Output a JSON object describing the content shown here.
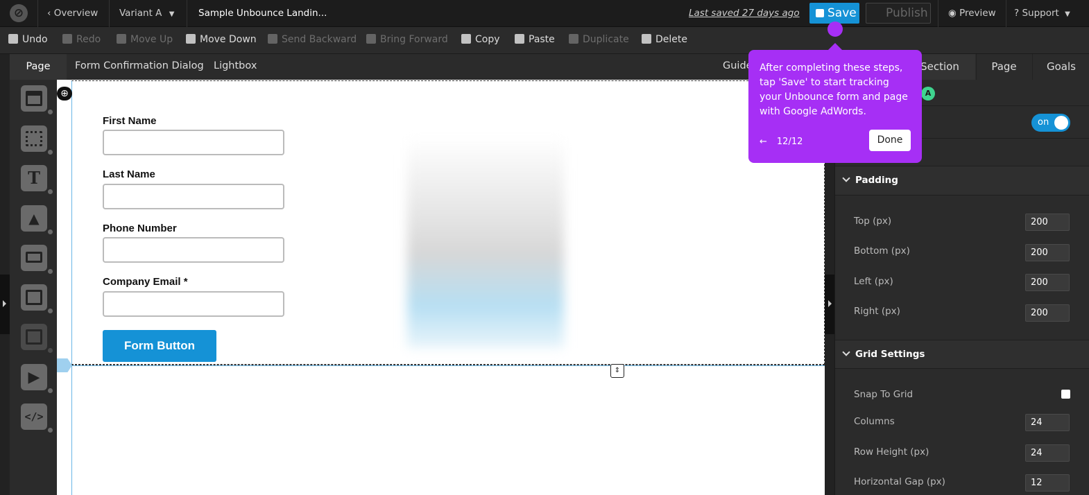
{
  "topbar": {
    "logo": "unbounce-logo-icon",
    "overview": "Overview",
    "variant": "Variant A",
    "page_name": "Sample Unbounce Landin...",
    "last_saved": "Last saved  27 days ago",
    "save": "Save",
    "publish": "Publish",
    "preview": "Preview",
    "support": "Support"
  },
  "toolbar": {
    "undo": "Undo",
    "redo": "Redo",
    "move_up": "Move Up",
    "move_down": "Move Down",
    "send_backward": "Send Backward",
    "bring_forward": "Bring Forward",
    "copy": "Copy",
    "paste": "Paste",
    "duplicate": "Duplicate",
    "delete": "Delete"
  },
  "tabs": {
    "page": "Page",
    "form_confirmation": "Form Confirmation Dialog",
    "lightbox": "Lightbox",
    "guides": "Guide"
  },
  "form": {
    "first_name": "First Name",
    "last_name": "Last Name",
    "phone": "Phone Number",
    "company_email": "Company Email *",
    "button": "Form Button"
  },
  "panel": {
    "tabs": {
      "section": "Section",
      "page": "Page",
      "goals": "Goals"
    },
    "badge": "A",
    "toggle": "on",
    "padding": {
      "title": "Padding",
      "top_label": "Top (px)",
      "top": "200",
      "bottom_label": "Bottom (px)",
      "bottom": "200",
      "left_label": "Left (px)",
      "left": "200",
      "right_label": "Right (px)",
      "right": "200"
    },
    "grid": {
      "title": "Grid Settings",
      "snap_label": "Snap To Grid",
      "columns_label": "Columns",
      "columns": "24",
      "row_height_label": "Row Height (px)",
      "row_height": "24",
      "hgap_label": "Horizontal Gap (px)",
      "hgap": "12"
    }
  },
  "tooltip": {
    "body": "After completing these steps, tap 'Save' to start tracking your Unbounce form and page with Google AdWords.",
    "step": "12/12",
    "done": "Done",
    "back_arrow": "←"
  },
  "colors": {
    "accent": "#1592d6",
    "tooltip": "#a62ff5",
    "toggle_badge": "#3fd48f"
  }
}
